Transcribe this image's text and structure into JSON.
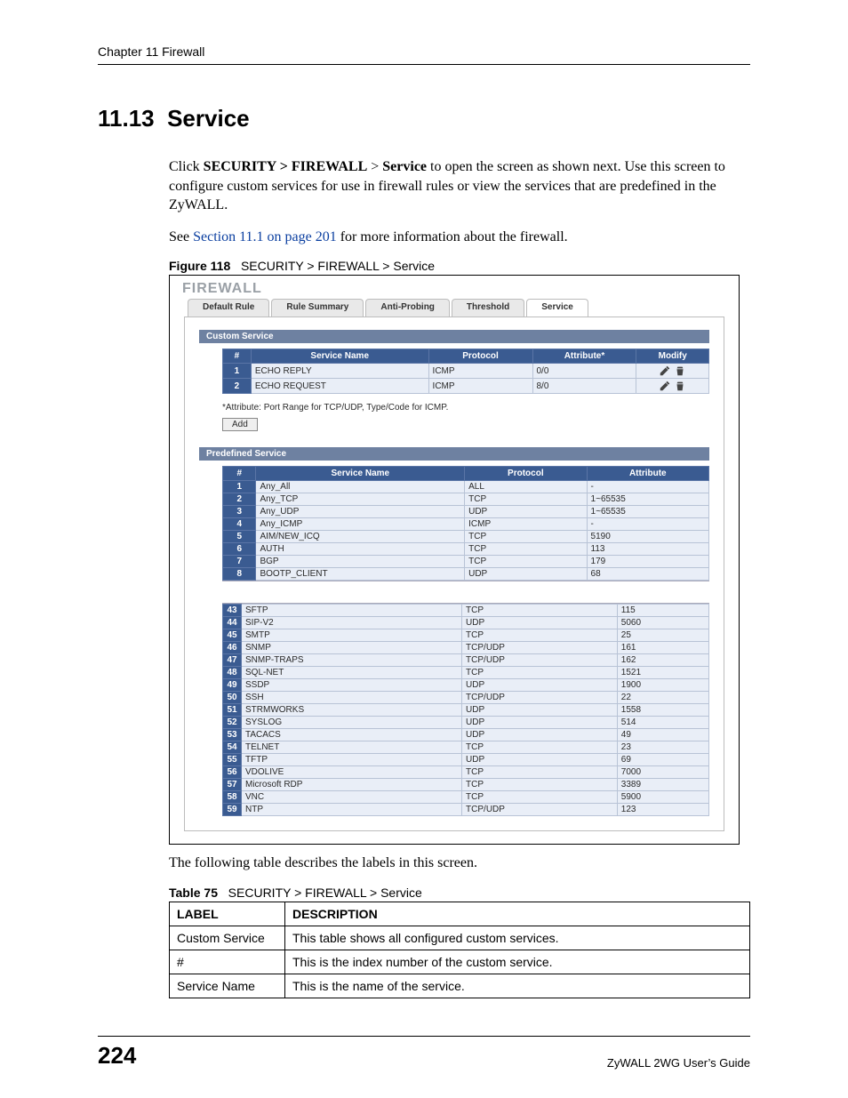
{
  "header": {
    "running": "Chapter 11 Firewall"
  },
  "heading": {
    "number": "11.13",
    "title": "Service"
  },
  "para1": {
    "pre": "Click ",
    "b1": "SECURITY > FIREWALL",
    "mid1": " > ",
    "b2": "Service",
    "post": " to open the screen as shown next. Use this screen to configure custom services for use in firewall rules or view the services that are predefined in the ZyWALL."
  },
  "para2": {
    "pre": "See ",
    "link": "Section 11.1 on page 201",
    "post": " for more information about the firewall."
  },
  "figcap": {
    "label": "Figure 118",
    "text": "SECURITY > FIREWALL > Service"
  },
  "shot": {
    "title": "FIREWALL",
    "tabs": [
      "Default Rule",
      "Rule Summary",
      "Anti-Probing",
      "Threshold",
      "Service"
    ],
    "active_tab": 4,
    "custom": {
      "bar": "Custom Service",
      "headers": [
        "#",
        "Service Name",
        "Protocol",
        "Attribute*",
        "Modify"
      ],
      "rows": [
        {
          "n": "1",
          "name": "ECHO REPLY",
          "proto": "ICMP",
          "attr": "0/0"
        },
        {
          "n": "2",
          "name": "ECHO REQUEST",
          "proto": "ICMP",
          "attr": "8/0"
        }
      ],
      "note": "*Attribute: Port Range for TCP/UDP, Type/Code for ICMP.",
      "add": "Add"
    },
    "predef": {
      "bar": "Predefined Service",
      "headers": [
        "#",
        "Service Name",
        "Protocol",
        "Attribute"
      ],
      "rows_top": [
        {
          "n": "1",
          "name": "Any_All",
          "proto": "ALL",
          "attr": "-"
        },
        {
          "n": "2",
          "name": "Any_TCP",
          "proto": "TCP",
          "attr": "1~65535"
        },
        {
          "n": "3",
          "name": "Any_UDP",
          "proto": "UDP",
          "attr": "1~65535"
        },
        {
          "n": "4",
          "name": "Any_ICMP",
          "proto": "ICMP",
          "attr": "-"
        },
        {
          "n": "5",
          "name": "AIM/NEW_ICQ",
          "proto": "TCP",
          "attr": "5190"
        },
        {
          "n": "6",
          "name": "AUTH",
          "proto": "TCP",
          "attr": "113"
        },
        {
          "n": "7",
          "name": "BGP",
          "proto": "TCP",
          "attr": "179"
        },
        {
          "n": "8",
          "name": "BOOTP_CLIENT",
          "proto": "UDP",
          "attr": "68"
        }
      ],
      "rows_bottom": [
        {
          "n": "43",
          "name": "SFTP",
          "proto": "TCP",
          "attr": "115"
        },
        {
          "n": "44",
          "name": "SIP-V2",
          "proto": "UDP",
          "attr": "5060"
        },
        {
          "n": "45",
          "name": "SMTP",
          "proto": "TCP",
          "attr": "25"
        },
        {
          "n": "46",
          "name": "SNMP",
          "proto": "TCP/UDP",
          "attr": "161"
        },
        {
          "n": "47",
          "name": "SNMP-TRAPS",
          "proto": "TCP/UDP",
          "attr": "162"
        },
        {
          "n": "48",
          "name": "SQL-NET",
          "proto": "TCP",
          "attr": "1521"
        },
        {
          "n": "49",
          "name": "SSDP",
          "proto": "UDP",
          "attr": "1900"
        },
        {
          "n": "50",
          "name": "SSH",
          "proto": "TCP/UDP",
          "attr": "22"
        },
        {
          "n": "51",
          "name": "STRMWORKS",
          "proto": "UDP",
          "attr": "1558"
        },
        {
          "n": "52",
          "name": "SYSLOG",
          "proto": "UDP",
          "attr": "514"
        },
        {
          "n": "53",
          "name": "TACACS",
          "proto": "UDP",
          "attr": "49"
        },
        {
          "n": "54",
          "name": "TELNET",
          "proto": "TCP",
          "attr": "23"
        },
        {
          "n": "55",
          "name": "TFTP",
          "proto": "UDP",
          "attr": "69"
        },
        {
          "n": "56",
          "name": "VDOLIVE",
          "proto": "TCP",
          "attr": "7000"
        },
        {
          "n": "57",
          "name": "Microsoft RDP",
          "proto": "TCP",
          "attr": "3389"
        },
        {
          "n": "58",
          "name": "VNC",
          "proto": "TCP",
          "attr": "5900"
        },
        {
          "n": "59",
          "name": "NTP",
          "proto": "TCP/UDP",
          "attr": "123"
        }
      ]
    }
  },
  "after": "The following table describes the labels in this screen.",
  "tabcap": {
    "label": "Table 75",
    "text": "SECURITY > FIREWALL > Service"
  },
  "desc": {
    "headers": [
      "LABEL",
      "DESCRIPTION"
    ],
    "rows": [
      [
        "Custom Service",
        "This table shows all configured custom services."
      ],
      [
        "#",
        "This is the index number of the custom service."
      ],
      [
        "Service Name",
        "This is the name of the service."
      ]
    ]
  },
  "footer": {
    "page": "224",
    "guide": "ZyWALL 2WG User’s Guide"
  }
}
